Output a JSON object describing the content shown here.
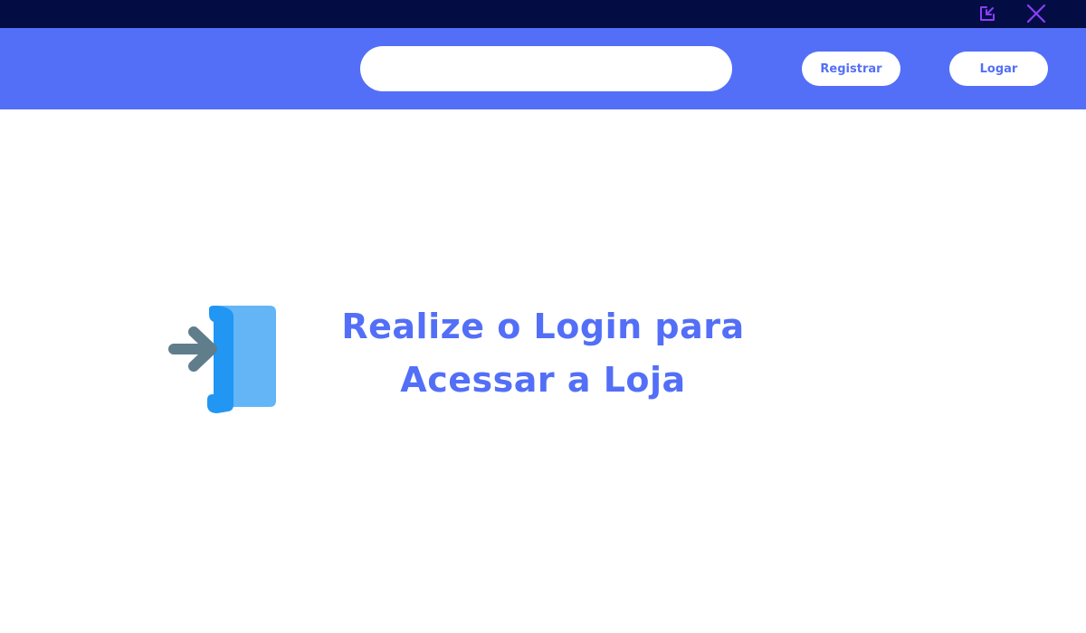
{
  "window": {
    "minimize_icon": "minimize-icon",
    "close_icon": "close-icon",
    "titlebar_color": "#030d44",
    "control_color": "#8a3ffc"
  },
  "header": {
    "background_color": "#536ff7",
    "search": {
      "value": "",
      "placeholder": ""
    },
    "register_label": "Registrar",
    "login_label": "Logar"
  },
  "main": {
    "icon": "login-door-icon",
    "headline_line1": "Realize o Login para",
    "headline_line2": "Acessar a Loja",
    "accent_color": "#536ff7"
  }
}
